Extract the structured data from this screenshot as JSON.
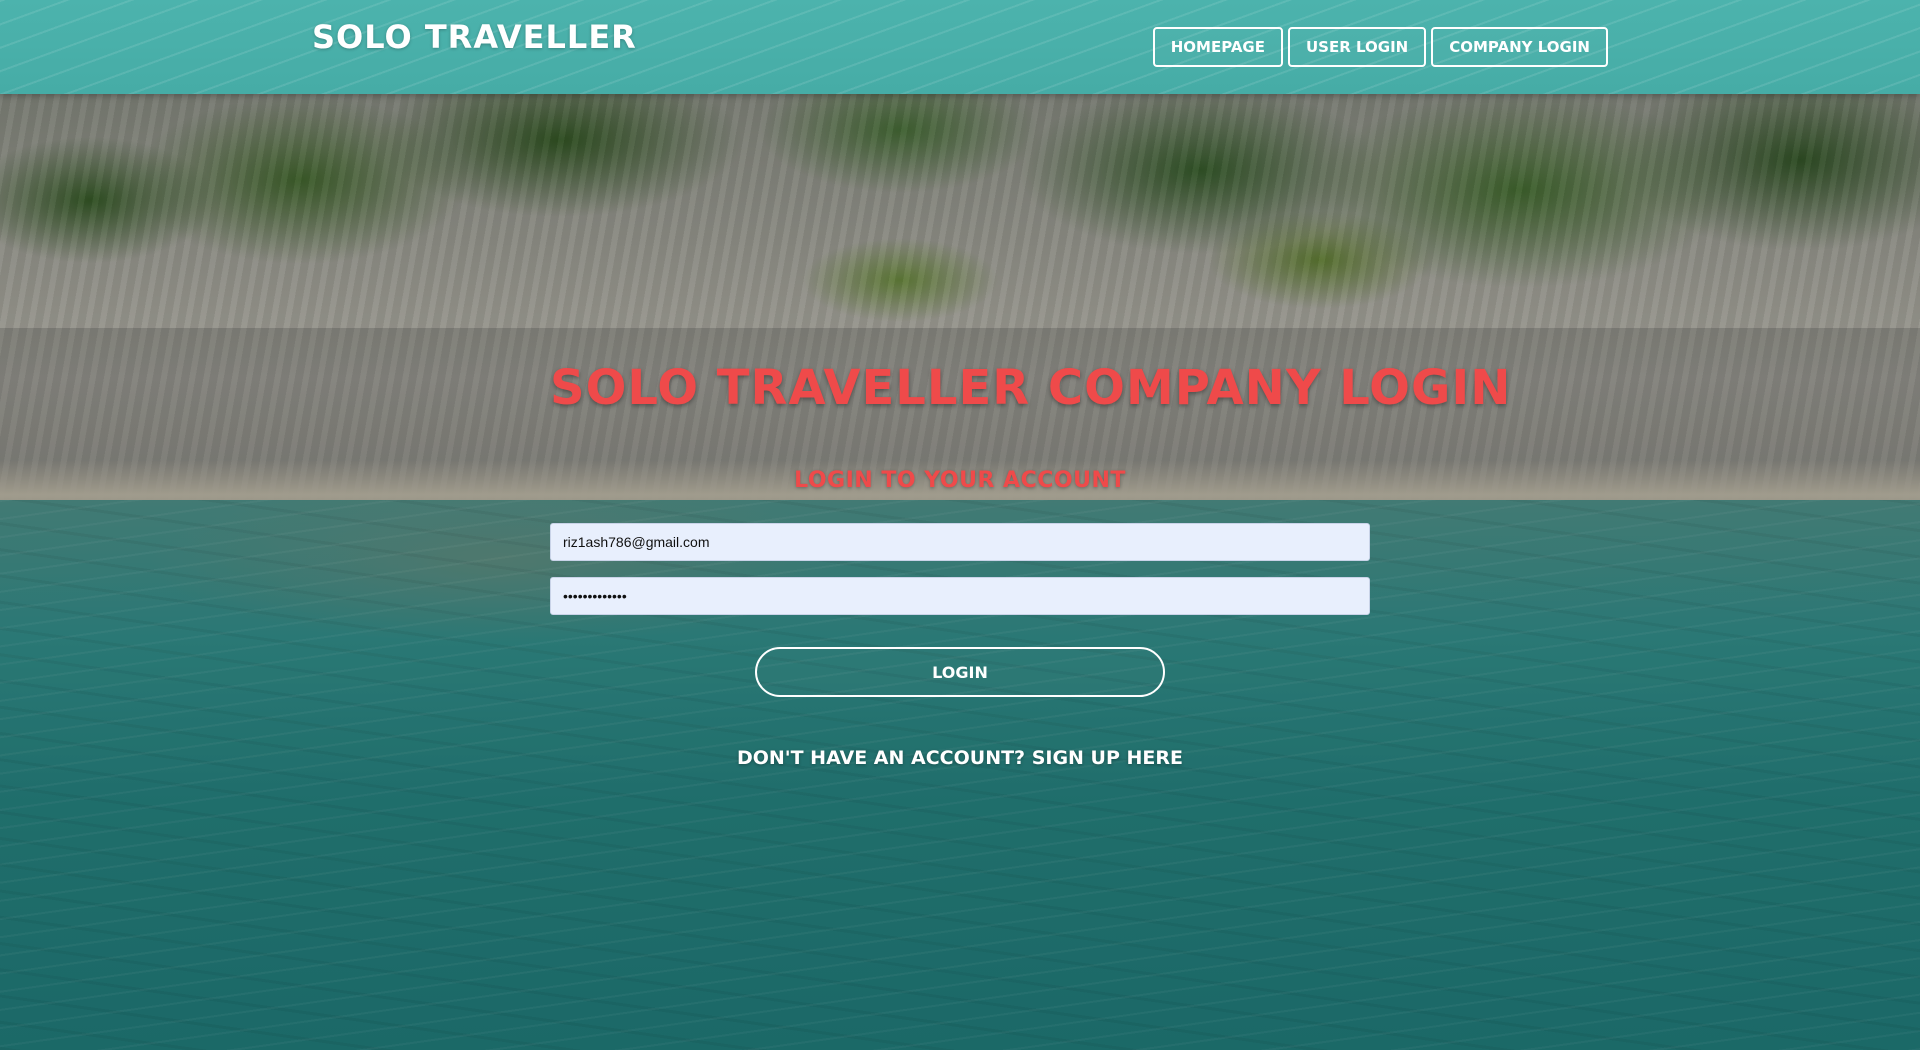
{
  "header": {
    "brand": "SOLO TRAVELLER",
    "nav": [
      {
        "label": "HOMEPAGE"
      },
      {
        "label": "USER LOGIN"
      },
      {
        "label": "COMPANY LOGIN"
      }
    ]
  },
  "login": {
    "title": "SOLO TRAVELLER COMPANY LOGIN",
    "subtitle": "LOGIN TO YOUR ACCOUNT",
    "email_value": "riz1ash786@gmail.com",
    "password_value": "•••••••••••••",
    "button_label": "LOGIN",
    "signup_text": "DON'T HAVE AN ACCOUNT? SIGN UP HERE"
  },
  "colors": {
    "header_bg": "#46aca6",
    "title_red": "#ef4a4a",
    "input_bg": "#e8effd",
    "text_white": "#ffffff"
  }
}
